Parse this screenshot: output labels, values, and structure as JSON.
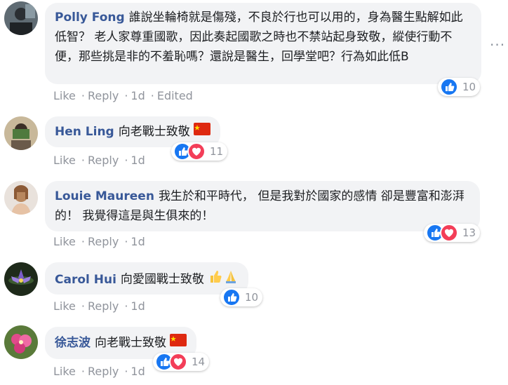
{
  "comments": [
    {
      "name": "Polly Fong",
      "text": "誰說坐輪椅就是傷殘，不良於行也可以用的，身為醫生點解如此低智？ 老人家尊重國歌，因此奏起國歌之時也不禁站起身致敬，縱使行動不便，那些挑是非的不羞恥嗎？還說是醫生，回學堂吧？行為如此低B",
      "like": "Like",
      "reply": "Reply",
      "time": "1d",
      "edited": "Edited",
      "reaction_count": "10",
      "reactions": [
        "like-icon"
      ]
    },
    {
      "name": "Hen Ling",
      "text": "向老戰士致敬",
      "emoji": [
        "china-flag-icon"
      ],
      "like": "Like",
      "reply": "Reply",
      "time": "1d",
      "reaction_count": "11",
      "reactions": [
        "like-icon",
        "love-icon"
      ]
    },
    {
      "name": "Louie Maureen",
      "text": "我生於和平時代， 但是我對於國家的感情 卻是豐富和澎湃的！ 我覺得這是與生俱來的！",
      "like": "Like",
      "reply": "Reply",
      "time": "1d",
      "reaction_count": "13",
      "reactions": [
        "like-icon",
        "love-icon"
      ]
    },
    {
      "name": "Carol Hui",
      "text": "向愛國戰士致敬",
      "emoji": [
        "thumbs-up-emoji",
        "pray-emoji"
      ],
      "like": "Like",
      "reply": "Reply",
      "time": "1d",
      "reaction_count": "10",
      "reactions": [
        "like-icon"
      ]
    },
    {
      "name": "徐志波",
      "text": "向老戰士致敬",
      "emoji": [
        "china-flag-icon"
      ],
      "like": "Like",
      "reply": "Reply",
      "time": "1d",
      "reaction_count": "14",
      "reactions": [
        "like-icon",
        "love-icon"
      ]
    }
  ],
  "colors": {
    "name": "#385898",
    "bubble": "#f2f3f5",
    "meta": "#90949c",
    "like_blue": "#1877f2",
    "love_red": "#f33e58"
  }
}
